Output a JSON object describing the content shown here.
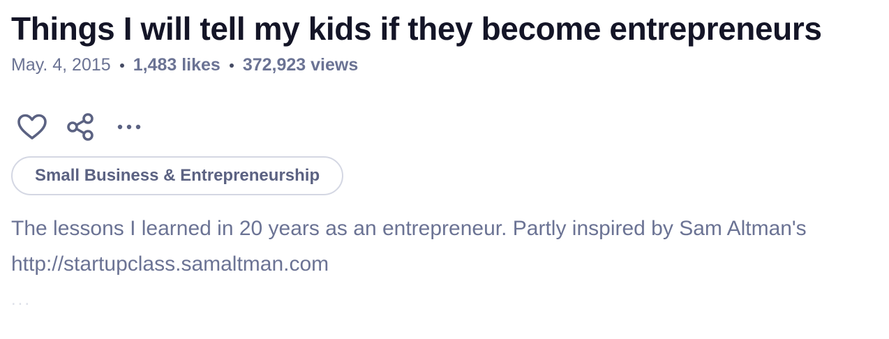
{
  "article": {
    "title": "Things I will tell my kids if they become entrepreneurs",
    "date": "May. 4, 2015",
    "likes": "1,483 likes",
    "views": "372,923 views",
    "tag": "Small Business & Entrepreneurship",
    "description_line1": "The lessons I learned in 20 years as an entrepreneur. Partly inspired by Sam Altman's",
    "description_line2": "http://startupclass.samaltman.com",
    "truncation": "..."
  },
  "actions": {
    "like_icon": "heart-icon",
    "share_icon": "share-icon",
    "more_icon": "more-horizontal-icon"
  },
  "colors": {
    "title": "#141527",
    "muted_text": "#6b7394",
    "icon": "#5b6282",
    "tag_border": "#d4d7e3"
  }
}
